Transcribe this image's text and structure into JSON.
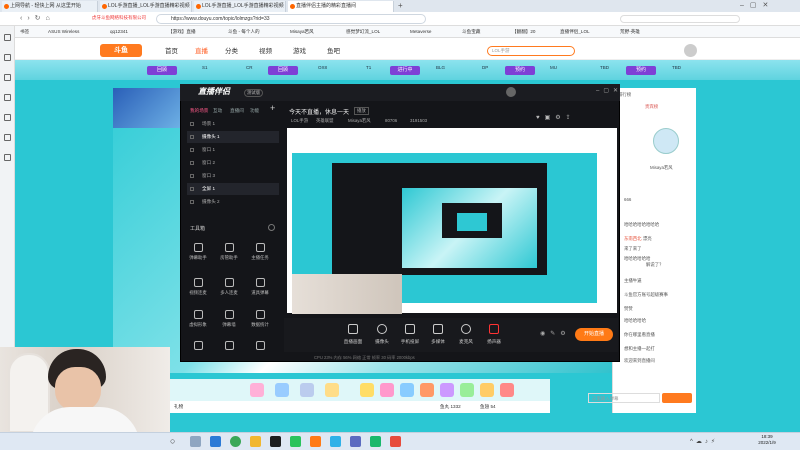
{
  "tabs": [
    {
      "label": "上网导航 - 轻快上网 从这里开始"
    },
    {
      "label": "LOL手游直播_LOL手游直播精彩视频"
    },
    {
      "label": "LOL手游直播_LOL手游直播精彩视频"
    },
    {
      "label": "直播伴侣主播的精彩直播间"
    }
  ],
  "address": {
    "url": "https://www.douyu.com/topic/lolmzgs?rid=33",
    "site_warning": "虎牙斗鱼网络科技有限公司"
  },
  "bookmarks": [
    "书签",
    "ASUS Wireless",
    "qq12341",
    "【游戏】直播",
    "斗鱼 - 每个人的",
    "Misaya若风",
    "感觉梦幻流_LOL",
    "Metaverse",
    "斗鱼宝藏",
    "【翻翻】20",
    "直播伴侣_LOL",
    "荒野-英雄"
  ],
  "nav": {
    "home": "首页",
    "live": "直播",
    "category": "分类",
    "video": "视频",
    "game": "游戏",
    "fishbar": "鱼吧",
    "search_placeholder": "LOL手游"
  },
  "logo_text": "斗鱼",
  "bracket": {
    "buttons": [
      "回顾",
      "回顾",
      "进行中",
      "预约",
      "预约"
    ],
    "labels": [
      "S1",
      "CR",
      "OX8",
      "T1",
      "BLG",
      "DP",
      "MU",
      "TBD",
      "TBD"
    ]
  },
  "app": {
    "title": "直播伴侣",
    "tag": "测试版",
    "tabs": [
      "我的场景",
      "互动",
      "直播间",
      "功能"
    ],
    "scenes": [
      "场景 1",
      "摄像头 1",
      "窗口 1",
      "窗口 2",
      "窗口 3",
      "全屏 1",
      "摄像头 2"
    ],
    "toolbox_title": "工具箱",
    "tools": [
      "弹幕助手",
      "房管助手",
      "主播任务",
      "视频连麦",
      "多人连麦",
      "道具弹幕",
      "虚拟形象",
      "弹幕墙",
      "数据统计",
      "直播设置",
      "更多",
      "美颜"
    ],
    "stream_title": "今天不直播，休息一天",
    "stream_tag": "播放",
    "stream_meta": [
      "LOL手游",
      "英雄联盟",
      "Misaya若风",
      "80706",
      "3191503"
    ],
    "controls": [
      "直播画面",
      "摄像头",
      "手机投屏",
      "多媒体",
      "麦克风",
      "扬声器"
    ],
    "go_live": "开始直播",
    "status": "CPU 23%  内存 56%  网络 正常  帧率 30  码率 2000kbps"
  },
  "chat": {
    "lines": [
      {
        "user": "",
        "text": "排行榜"
      },
      {
        "user": "",
        "text": "贵宾榜"
      },
      {
        "user": "主播",
        "text": "Misaya若风"
      },
      {
        "user": "",
        "text": "666"
      },
      {
        "user": "",
        "text": "哈哈哈哈哈哈哈哈"
      },
      {
        "user": "东南西北",
        "text": "漂亮"
      },
      {
        "user": "",
        "text": "来了来了"
      },
      {
        "user": "",
        "text": "哈哈哈哈哈哈"
      },
      {
        "user": "",
        "text": "解说了？"
      },
      {
        "user": "",
        "text": "主播牛逼"
      },
      {
        "user": "",
        "text": "斗鱼官方账号超级赛事"
      },
      {
        "user": "",
        "text": "赞赞"
      },
      {
        "user": "",
        "text": "哈哈哈哈哈"
      },
      {
        "user": "",
        "text": "你在哪里看直播"
      },
      {
        "user": "",
        "text": "想和主播一起打"
      },
      {
        "user": "",
        "text": "欢迎来到直播间"
      }
    ],
    "input_placeholder": "这里输入弹幕"
  },
  "bottom": {
    "gift_label": "礼物",
    "fans": "鱼丸 1332",
    "level": "鱼翅 54"
  },
  "clock": {
    "time": "18:39",
    "date": "2022/1/9"
  }
}
